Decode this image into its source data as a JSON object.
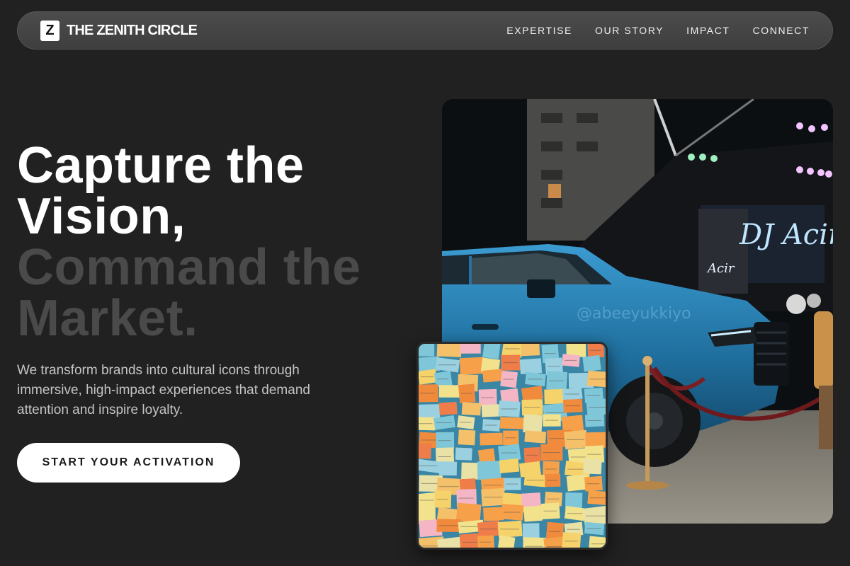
{
  "brand": {
    "logo_letter": "Z",
    "name": "THE ZENITH CIRCLE"
  },
  "nav": {
    "items": [
      {
        "label": "EXPERTISE"
      },
      {
        "label": "OUR STORY"
      },
      {
        "label": "IMPACT"
      },
      {
        "label": "CONNECT"
      }
    ]
  },
  "hero": {
    "headline_line1": "Capture the",
    "headline_line2": "Vision,",
    "headline_line3": "Command the",
    "headline_line4": "Market.",
    "subtext": "We transform brands into cultural icons through immersive, high-impact experiences that demand attention and inspire loyalty.",
    "cta_label": "START YOUR ACTIVATION"
  },
  "images": {
    "main": "event-truck-display-photo",
    "secondary": "sticky-notes-wall-photo"
  },
  "colors": {
    "background": "#212121",
    "nav_background": "#444444",
    "headline_primary": "#ffffff",
    "headline_muted": "#4a4a4a",
    "cta_background": "#ffffff"
  }
}
